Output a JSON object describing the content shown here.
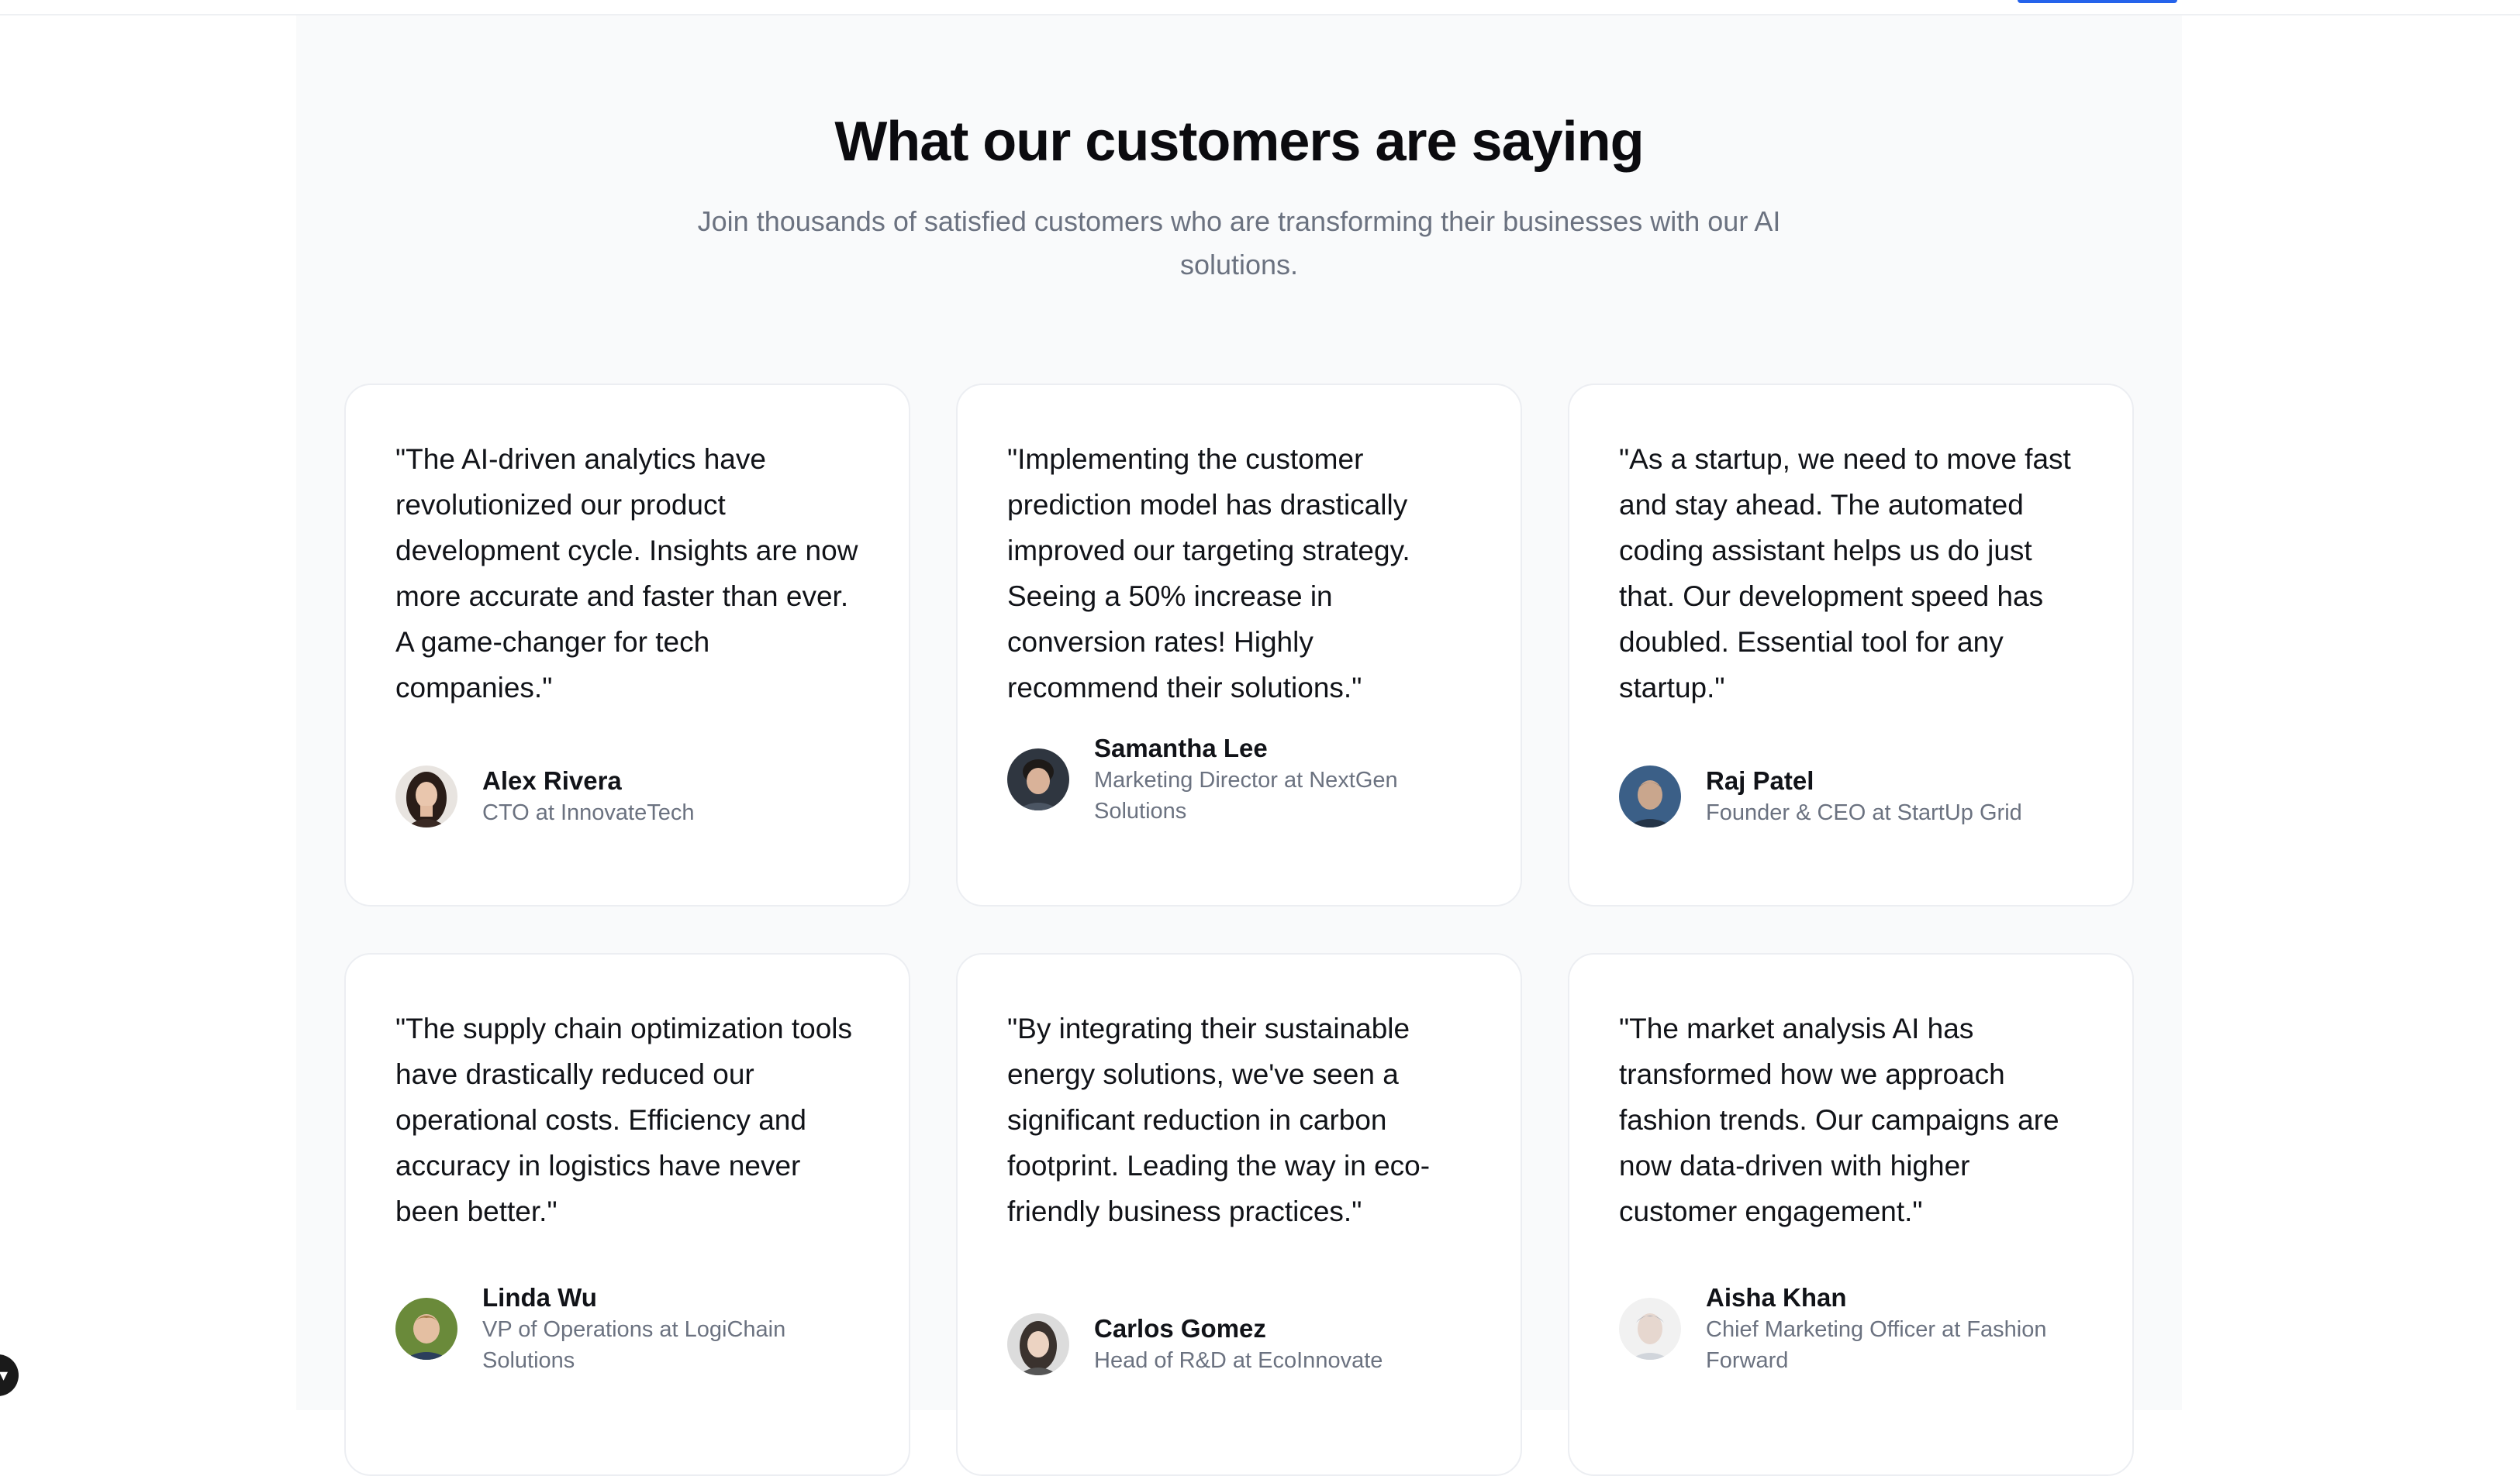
{
  "header": {
    "title": "What our customers are saying",
    "subtitle": "Join thousands of satisfied customers who are transforming their businesses with our AI solutions."
  },
  "testimonials": [
    {
      "quote": "\"The AI-driven analytics have revolutionized our product development cycle. Insights are now more accurate and faster than ever. A game-changer for tech companies.\"",
      "name": "Alex Rivera",
      "role": "CTO at InnovateTech"
    },
    {
      "quote": "\"Implementing the customer prediction model has drastically improved our targeting strategy. Seeing a 50% increase in conversion rates! Highly recommend their solutions.\"",
      "name": "Samantha Lee",
      "role": "Marketing Director at NextGen Solutions"
    },
    {
      "quote": "\"As a startup, we need to move fast and stay ahead. The automated coding assistant helps us do just that. Our development speed has doubled. Essential tool for any startup.\"",
      "name": "Raj Patel",
      "role": "Founder & CEO at StartUp Grid"
    },
    {
      "quote": "\"The supply chain optimization tools have drastically reduced our operational costs. Efficiency and accuracy in logistics have never been better.\"",
      "name": "Linda Wu",
      "role": "VP of Operations at LogiChain Solutions"
    },
    {
      "quote": "\"By integrating their sustainable energy solutions, we've seen a significant reduction in carbon footprint. Leading the way in eco-friendly business practices.\"",
      "name": "Carlos Gomez",
      "role": "Head of R&D at EcoInnovate"
    },
    {
      "quote": "\"The market analysis AI has transformed how we approach fashion trends. Our campaigns are now data-driven with higher customer engagement.\"",
      "name": "Aisha Khan",
      "role": "Chief Marketing Officer at Fashion Forward"
    }
  ],
  "icons": {
    "floating_button": "chevron-down-icon"
  },
  "colors": {
    "accent": "#2563eb",
    "section_bg": "#f9fafb",
    "muted_text": "#6b7280"
  }
}
